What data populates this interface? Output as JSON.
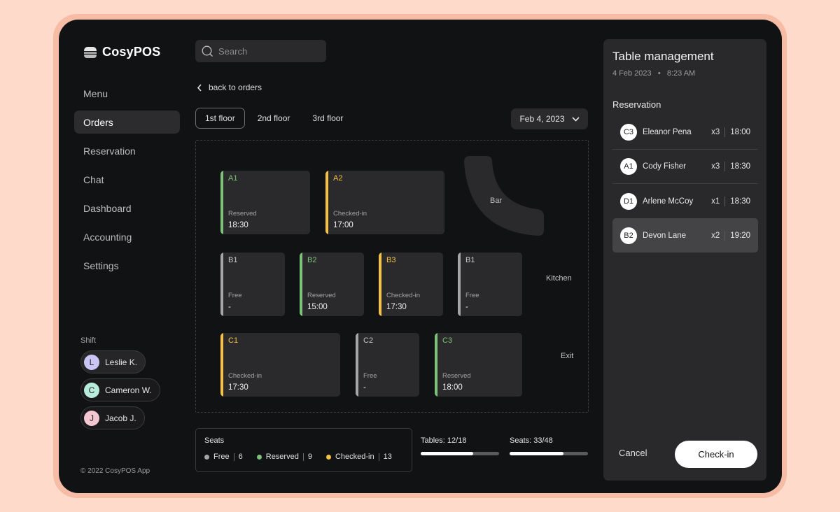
{
  "app": {
    "name": "CosyPOS",
    "copyright": "© 2022 CosyPOS App"
  },
  "colors": {
    "free": "#a6a6a8",
    "reserved": "#7ec27a",
    "checked_in": "#f7c244",
    "background": "#111214",
    "panel": "#29292b"
  },
  "sidebar": {
    "items": [
      {
        "label": "Menu",
        "active": false
      },
      {
        "label": "Orders",
        "active": true
      },
      {
        "label": "Reservation",
        "active": false
      },
      {
        "label": "Chat",
        "active": false
      },
      {
        "label": "Dashboard",
        "active": false
      },
      {
        "label": "Accounting",
        "active": false
      },
      {
        "label": "Settings",
        "active": false
      }
    ],
    "shift": {
      "label": "Shift",
      "staff": [
        {
          "initial": "L",
          "name": "Leslie K.",
          "color": "#c9c6f5"
        },
        {
          "initial": "C",
          "name": "Cameron W.",
          "color": "#b6ecd9"
        },
        {
          "initial": "J",
          "name": "Jacob J.",
          "color": "#f3c6d1"
        }
      ]
    }
  },
  "search": {
    "placeholder": "Search",
    "value": ""
  },
  "back_link": "back to orders",
  "floors": {
    "tabs": [
      {
        "label": "1st floor",
        "active": true
      },
      {
        "label": "2nd floor",
        "active": false
      },
      {
        "label": "3rd floor",
        "active": false
      }
    ],
    "date": "Feb 4, 2023"
  },
  "floor_plan": {
    "areas": {
      "bar": "Bar",
      "kitchen": "Kitchen",
      "exit": "Exit"
    },
    "tables": [
      {
        "id": "A1",
        "status": "reserved",
        "status_label": "Reserved",
        "time": "18:30"
      },
      {
        "id": "A2",
        "status": "checked_in",
        "status_label": "Checked-in",
        "time": "17:00"
      },
      {
        "id": "B1",
        "status": "free",
        "status_label": "Free",
        "time": "-"
      },
      {
        "id": "B2",
        "status": "reserved",
        "status_label": "Reserved",
        "time": "15:00"
      },
      {
        "id": "B3",
        "status": "checked_in",
        "status_label": "Checked-in",
        "time": "17:30"
      },
      {
        "id": "B1",
        "status": "free",
        "status_label": "Free",
        "time": "-"
      },
      {
        "id": "C1",
        "status": "checked_in",
        "status_label": "Checked-in",
        "time": "17:30"
      },
      {
        "id": "C2",
        "status": "free",
        "status_label": "Free",
        "time": "-"
      },
      {
        "id": "C3",
        "status": "reserved",
        "status_label": "Reserved",
        "time": "18:00"
      }
    ]
  },
  "seats_summary": {
    "title": "Seats",
    "legend": [
      {
        "status": "free",
        "label": "Free",
        "count": "6"
      },
      {
        "status": "reserved",
        "label": "Reserved",
        "count": "9"
      },
      {
        "status": "checked_in",
        "label": "Checked-in",
        "count": "13"
      }
    ]
  },
  "occupancy": {
    "tables": {
      "label": "Tables: 12/18",
      "fraction": 0.667
    },
    "seats": {
      "label": "Seats: 33/48",
      "fraction": 0.6875
    }
  },
  "panel": {
    "title": "Table management",
    "date": "4 Feb 2023",
    "time": "8:23 AM",
    "reservation_title": "Reservation",
    "reservations": [
      {
        "table": "C3",
        "name": "Eleanor Pena",
        "guests": "x3",
        "time": "18:00",
        "selected": false
      },
      {
        "table": "A1",
        "name": "Cody Fisher",
        "guests": "x3",
        "time": "18:30",
        "selected": false
      },
      {
        "table": "D1",
        "name": "Arlene McCoy",
        "guests": "x1",
        "time": "18:30",
        "selected": false
      },
      {
        "table": "B2",
        "name": "Devon Lane",
        "guests": "x2",
        "time": "19:20",
        "selected": true
      }
    ],
    "cancel_label": "Cancel",
    "checkin_label": "Check-in"
  }
}
